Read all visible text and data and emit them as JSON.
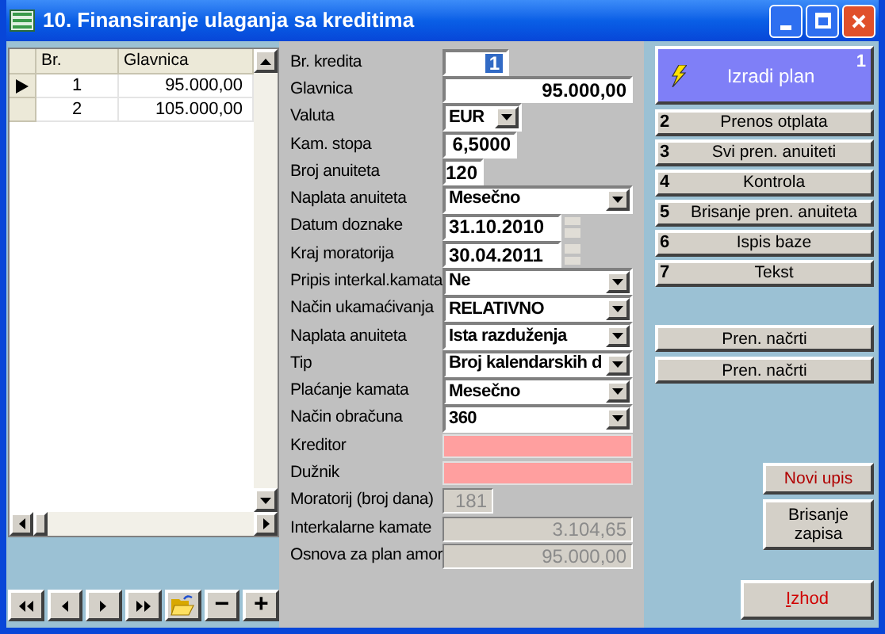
{
  "window": {
    "title": "10. Finansiranje ulaganja sa kreditima"
  },
  "grid": {
    "columns": [
      "Br.",
      "Glavnica"
    ],
    "rows": [
      {
        "cells": [
          "1",
          "95.000,00"
        ],
        "current": true
      },
      {
        "cells": [
          "2",
          "105.000,00"
        ],
        "current": false
      }
    ]
  },
  "nav_buttons": [
    {
      "kind": "first"
    },
    {
      "kind": "prev"
    },
    {
      "kind": "next"
    },
    {
      "kind": "last"
    },
    {
      "kind": "open"
    },
    {
      "kind": "text",
      "label": "−"
    },
    {
      "kind": "text",
      "label": "+"
    }
  ],
  "form": {
    "fields": [
      {
        "label": "Br. kredita",
        "kind": "text",
        "value": "1",
        "selected": true
      },
      {
        "label": "Glavnica",
        "kind": "text",
        "value": "95.000,00",
        "selected": false
      },
      {
        "label": "Valuta",
        "kind": "combo",
        "value": "EUR"
      },
      {
        "label": "Kam. stopa",
        "kind": "text",
        "value": "6,5000",
        "selected": false
      },
      {
        "label": "Broj anuiteta",
        "kind": "text",
        "value": "120",
        "selected": false
      },
      {
        "label": "Naplata anuiteta",
        "kind": "combo",
        "value": "Mesečno"
      },
      {
        "label": "Datum doznake",
        "kind": "date",
        "value": "31.10.2010"
      },
      {
        "label": "Kraj moratorija",
        "kind": "date",
        "value": "30.04.2011"
      },
      {
        "label": "Pripis interkal.kamata",
        "kind": "combo",
        "value": "Ne"
      },
      {
        "label": "Način ukamaćivanja",
        "kind": "combo",
        "value": "RELATIVNO"
      },
      {
        "label": "Naplata anuiteta",
        "kind": "combo",
        "value": "Ista razduženja"
      },
      {
        "label": "Tip",
        "kind": "combo",
        "value": "Broj kalendarskih d"
      },
      {
        "label": "Plaćanje kamata",
        "kind": "combo",
        "value": "Mesečno"
      },
      {
        "label": "Način obračuna",
        "kind": "combo",
        "value": "360"
      },
      {
        "label": "Kreditor",
        "kind": "required"
      },
      {
        "label": "Dužnik",
        "kind": "required"
      },
      {
        "label": "Moratorij (broj dana)",
        "kind": "readonly",
        "value": "181"
      },
      {
        "label": "Interkalarne kamate",
        "kind": "readonly",
        "value": "3.104,65"
      },
      {
        "label": "Osnova za plan amor",
        "kind": "readonly",
        "value": "95.000,00"
      }
    ]
  },
  "actions": {
    "primary": {
      "label": "Izradi plan",
      "number": "1"
    },
    "numbered": [
      {
        "number": "2",
        "label": "Prenos otplata"
      },
      {
        "number": "3",
        "label": "Svi pren. anuiteti"
      },
      {
        "number": "4",
        "label": "Kontrola"
      },
      {
        "number": "5",
        "label": "Brisanje pren. anuiteta"
      },
      {
        "number": "6",
        "label": "Ispis baze"
      },
      {
        "number": "7",
        "label": "Tekst"
      }
    ],
    "extra": [
      "Pren. načrti",
      "Pren. načrti"
    ]
  },
  "record_buttons": [
    {
      "label": "Novi upis",
      "kind": "new"
    },
    {
      "label": "Brisanje zapisa",
      "kind": "delete"
    }
  ],
  "exit": {
    "label": "Izhod"
  }
}
